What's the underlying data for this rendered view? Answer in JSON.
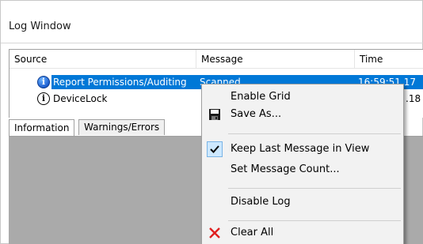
{
  "window": {
    "title": "Log Window"
  },
  "columns": [
    "Source",
    "Message",
    "Time"
  ],
  "rows": [
    {
      "icon": "info-icon",
      "source": "Report Permissions/Auditing",
      "message": "Scanned",
      "time": "16:59:51.17\u0000"
    },
    {
      "icon": "info-icon",
      "source": "DeviceLock",
      "message": "",
      "time": ".18"
    }
  ],
  "tabs": [
    "Information",
    "Warnings/Errors"
  ],
  "context_menu": {
    "items": [
      {
        "label": "Enable Grid",
        "icon": ""
      },
      {
        "label": "Save As...",
        "icon": "floppy-disk-icon"
      },
      {
        "label": "Keep Last Message in View",
        "icon": "checkmark-icon",
        "checked": true
      },
      {
        "label": "Set Message Count...",
        "icon": ""
      },
      {
        "label": "Disable Log",
        "icon": ""
      },
      {
        "label": "Clear All",
        "icon": "red-x-icon"
      }
    ]
  },
  "colors": {
    "selection": "#0078d7",
    "menu_bg": "#f2f2f2",
    "gray_area": "#aaaaaa"
  }
}
